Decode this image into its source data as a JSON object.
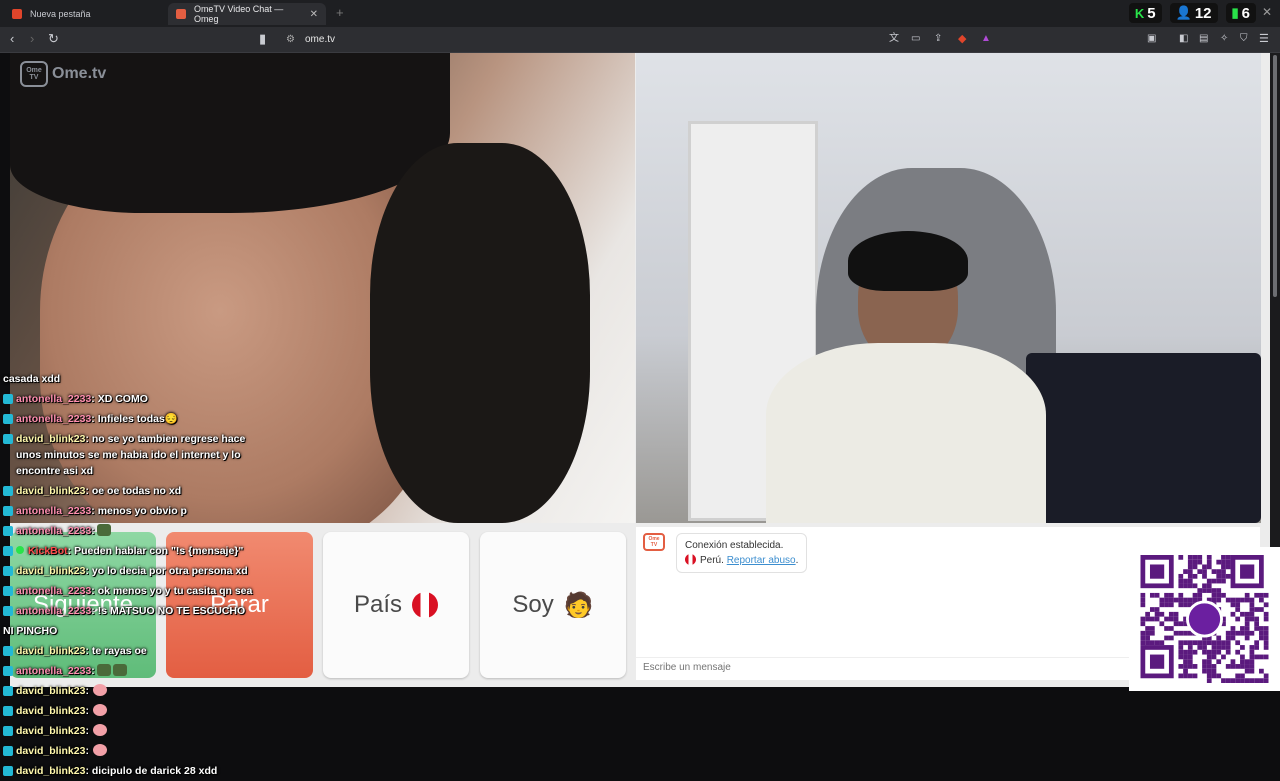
{
  "browser": {
    "tabs": [
      {
        "title": "Nueva pestaña",
        "active": false
      },
      {
        "title": "OmeTV Video Chat — Omeg",
        "active": true
      }
    ],
    "url": "ome.tv",
    "stats": [
      {
        "icon": "kick-icon",
        "value": "5"
      },
      {
        "icon": "user-icon",
        "value": "12"
      },
      {
        "icon": "bars-icon",
        "value": "6"
      }
    ]
  },
  "logo": {
    "box": "Ome TV",
    "text": "Ome.tv"
  },
  "buttons": {
    "next": "Siguiente",
    "stop": "Parar",
    "country": "País",
    "gender": "Soy",
    "gender_emoji": "🧑"
  },
  "chat": {
    "system_label": "Ome TV",
    "connected": "Conexión establecida.",
    "country": "Perú.",
    "report": "Reportar abuso",
    "input_placeholder": "Escribe un mensaje"
  },
  "overlay_chat": [
    {
      "user": "",
      "text": "casada xdd",
      "plain": true
    },
    {
      "user": "antonella_2233",
      "text": ": XD COMO"
    },
    {
      "user": "antonella_2233",
      "text": ": Infieles todas😔"
    },
    {
      "user": "david_blink23",
      "text": ": no se yo tambien regrese hace unos minutos se me habia ido el internet y lo encontre asi xd",
      "wrap": true
    },
    {
      "user": "david_blink23",
      "text": ": oe oe todas no xd"
    },
    {
      "user": "antonella_2233",
      "text": ": menos yo obvio p"
    },
    {
      "user": "antonella_2233",
      "text": ":",
      "emote": true
    },
    {
      "user": "KickBot",
      "text": ": Pueden hablar con \"!s {mensaje}\"",
      "bot": true
    },
    {
      "user": "david_blink23",
      "text": ": yo lo decia por otra persona xd"
    },
    {
      "user": "antonella_2233",
      "text": ": ok menos yo y tu casita qn sea"
    },
    {
      "user": "antonella_2233",
      "text": ": !s MATSUO NO TE ESCUCHO"
    },
    {
      "user": "",
      "text": "NI PINCHO",
      "plain": true
    },
    {
      "user": "david_blink23",
      "text": ": te rayas oe"
    },
    {
      "user": "antonella_2233",
      "text": ":",
      "emote": true,
      "emote2": true
    },
    {
      "user": "david_blink23",
      "text": ":",
      "pig": true
    },
    {
      "user": "david_blink23",
      "text": ":",
      "pig": true
    },
    {
      "user": "david_blink23",
      "text": ":",
      "pig": true
    },
    {
      "user": "david_blink23",
      "text": ":",
      "pig": true
    },
    {
      "user": "david_blink23",
      "text": ": dicipulo de darick 28 xdd"
    }
  ],
  "colors": {
    "next": "#6cc487",
    "stop": "#e86b4f",
    "link": "#3c8ecf",
    "stat_green": "#29e34a"
  }
}
